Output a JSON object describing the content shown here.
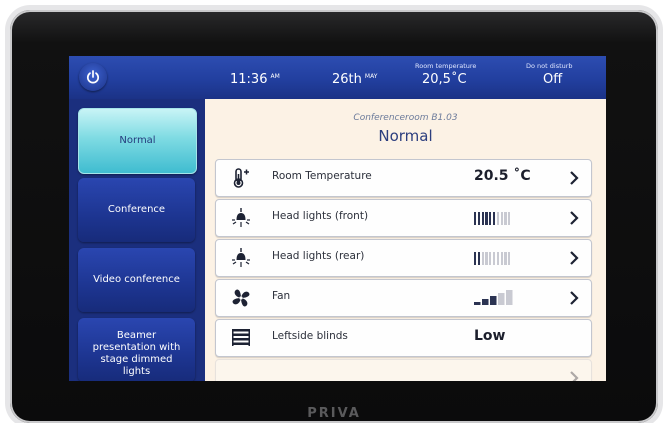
{
  "device": {
    "brand": "PRIVA"
  },
  "topbar": {
    "time": "11:36",
    "time_suffix": "AM",
    "date": "26th",
    "date_suffix": "MAY",
    "room_temp_label": "Room temperature",
    "room_temp_value": "20,5˚C",
    "dnd_label": "Do not disturb",
    "dnd_value": "Off",
    "power_icon": "power-icon"
  },
  "modes": [
    {
      "label": "Normal",
      "active": true
    },
    {
      "label": "Conference",
      "active": false
    },
    {
      "label": "Video conference",
      "active": false
    },
    {
      "label": "Beamer presentation with stage dimmed lights",
      "active": false
    }
  ],
  "header": {
    "room": "Conferenceroom B1.03",
    "mode": "Normal"
  },
  "rows": [
    {
      "icon": "thermometer-icon",
      "label": "Room Temperature",
      "value": "20.5 ˚C"
    },
    {
      "icon": "head-light-icon",
      "label": "Head lights (front)",
      "level": 0.6
    },
    {
      "icon": "head-light-icon",
      "label": "Head lights (rear)",
      "level": 0.2
    },
    {
      "icon": "fan-icon",
      "label": "Fan",
      "level": 0.5
    },
    {
      "icon": "blinds-icon",
      "label": "Leftside blinds",
      "value": "Low"
    }
  ],
  "colors": {
    "topbar": "#223f9f",
    "sidebar": "#1b2f7e",
    "active_mode": "#7fdbe3",
    "content_bg": "#fcf2e5",
    "accent_text": "#2c3e7e"
  }
}
